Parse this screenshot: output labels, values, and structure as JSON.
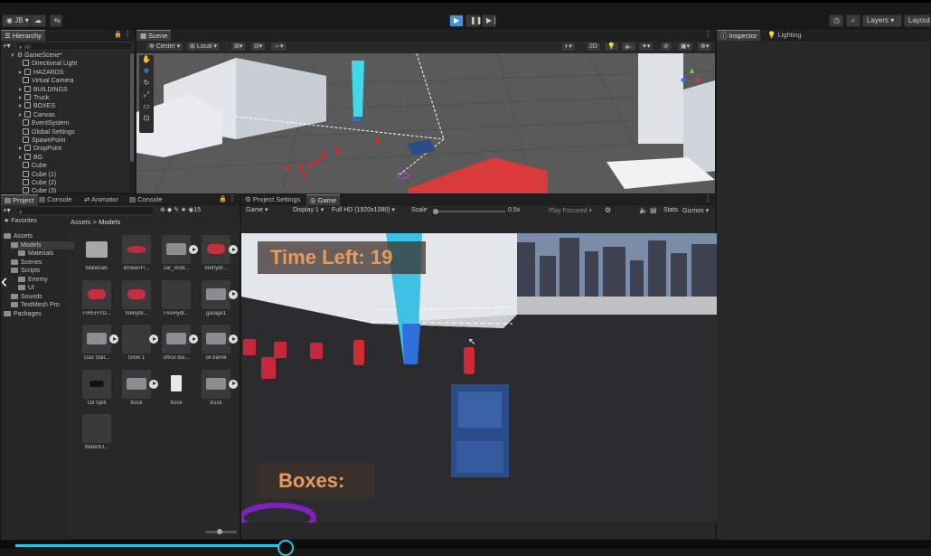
{
  "topbar": {
    "account": "JB",
    "layers": "Layers",
    "layout": "Layout"
  },
  "hierarchy": {
    "tab": "Hierarchy",
    "search_placeholder": "All",
    "scene": "GameScene*",
    "items": [
      {
        "label": "Directional Light",
        "type": "obj"
      },
      {
        "label": "HAZARDS",
        "type": "group"
      },
      {
        "label": "Virtual Camera",
        "type": "obj"
      },
      {
        "label": "BUILDINGS",
        "type": "group"
      },
      {
        "label": "Truck",
        "type": "group"
      },
      {
        "label": "BOXES",
        "type": "group"
      },
      {
        "label": "Canvas",
        "type": "group"
      },
      {
        "label": "EventSystem",
        "type": "obj"
      },
      {
        "label": "Global Settings",
        "type": "obj"
      },
      {
        "label": "SpawnPoint",
        "type": "obj"
      },
      {
        "label": "DropPoint",
        "type": "group"
      },
      {
        "label": "BG",
        "type": "group"
      },
      {
        "label": "Cube",
        "type": "obj"
      },
      {
        "label": "Cube (1)",
        "type": "obj"
      },
      {
        "label": "Cube (2)",
        "type": "obj"
      },
      {
        "label": "Cube (3)",
        "type": "obj"
      }
    ]
  },
  "scene": {
    "tab": "Scene",
    "center": "Center",
    "local": "Local",
    "mode_2d": "2D"
  },
  "inspector": {
    "tab_inspector": "Inspector",
    "tab_lighting": "Lighting"
  },
  "project": {
    "tabs": [
      "Project",
      "Console",
      "Animator",
      "Console"
    ],
    "hidden_count": "15",
    "favorites": "Favorites",
    "breadcrumb_root": "Assets",
    "breadcrumb_sep": ">",
    "breadcrumb_leaf": "Models",
    "tree": [
      {
        "label": "Assets",
        "indent": 0
      },
      {
        "label": "Models",
        "indent": 1
      },
      {
        "label": "Materials",
        "indent": 2
      },
      {
        "label": "Scenes",
        "indent": 1
      },
      {
        "label": "Scripts",
        "indent": 1
      },
      {
        "label": "Enemy",
        "indent": 2
      },
      {
        "label": "UI",
        "indent": 2
      },
      {
        "label": "Sounds",
        "indent": 1
      },
      {
        "label": "TextMesh Pro",
        "indent": 1
      },
      {
        "label": "Packages",
        "indent": 0
      }
    ],
    "assets": [
      {
        "label": "Materials",
        "kind": "folder"
      },
      {
        "label": "BrokenFi...",
        "kind": "red-flat"
      },
      {
        "label": "car_mod...",
        "kind": "grey",
        "play": true
      },
      {
        "label": "firehydr...",
        "kind": "red",
        "play": true
      },
      {
        "label": "FIREHYD...",
        "kind": "red"
      },
      {
        "label": "firehydr...",
        "kind": "red"
      },
      {
        "label": "FireHydr...",
        "kind": "empty"
      },
      {
        "label": "garage1",
        "kind": "grey",
        "play": true
      },
      {
        "label": "Gas Stat...",
        "kind": "grey",
        "play": true
      },
      {
        "label": "Glow 1",
        "kind": "empty",
        "play": true
      },
      {
        "label": "office bui...",
        "kind": "grey",
        "play": true
      },
      {
        "label": "oil barrel",
        "kind": "grey",
        "play": true
      },
      {
        "label": "Oil Spill",
        "kind": "dark"
      },
      {
        "label": "truck",
        "kind": "grey",
        "play": true
      },
      {
        "label": "truck",
        "kind": "file"
      },
      {
        "label": "truck",
        "kind": "grey",
        "play": true
      },
      {
        "label": "WaterEf...",
        "kind": "empty"
      }
    ]
  },
  "game": {
    "tab_settings": "Project Settings",
    "tab_game": "Game",
    "mode": "Game",
    "display": "Display 1",
    "resolution": "Full HD (1920x1080)",
    "scale_label": "Scale",
    "scale_value": "0.5x",
    "play_focused": "Play Focused",
    "stats": "Stats",
    "gizmos": "Gizmos",
    "time_left_label": "Time Left:",
    "time_left_value": "19",
    "boxes_label": "Boxes:"
  },
  "video_progress": 0.307,
  "colors": {
    "accent": "#4a8fd8",
    "hud_text": "#e89a5a",
    "progress": "#1ec8e6"
  }
}
